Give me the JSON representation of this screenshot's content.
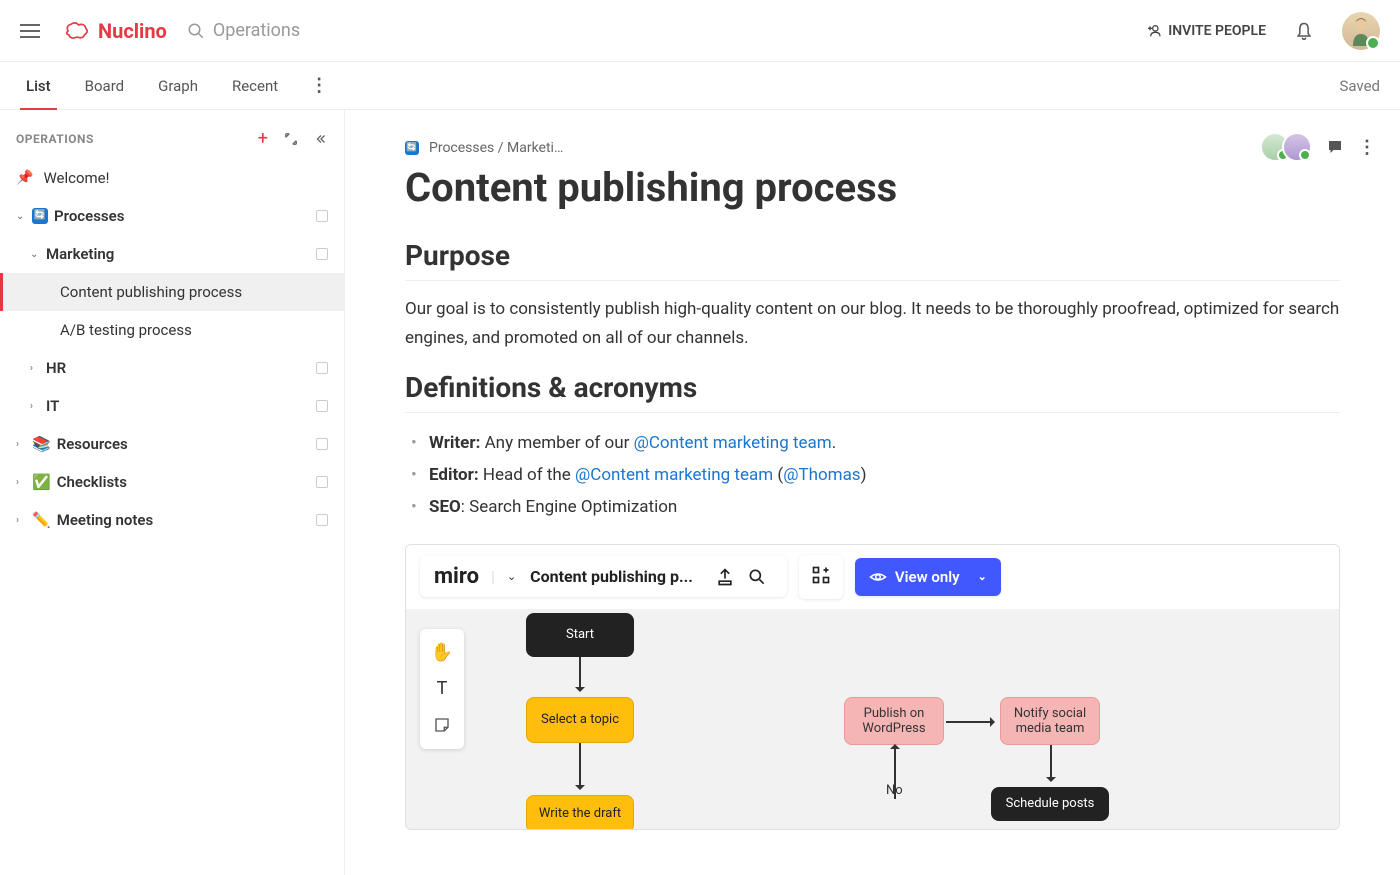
{
  "header": {
    "logo": "Nuclino",
    "search_placeholder": "Operations",
    "invite_label": "INVITE PEOPLE",
    "saved_label": "Saved"
  },
  "tabs": {
    "list": "List",
    "board": "Board",
    "graph": "Graph",
    "recent": "Recent"
  },
  "sidebar": {
    "label": "OPERATIONS",
    "welcome": "Welcome!",
    "processes": "Processes",
    "marketing": "Marketing",
    "content_publishing": "Content publishing process",
    "ab_testing": "A/B testing process",
    "hr": "HR",
    "it": "IT",
    "resources": "Resources",
    "checklists": "Checklists",
    "meeting_notes": "Meeting notes"
  },
  "page": {
    "breadcrumb": "Processes / Marketi…",
    "title": "Content publishing process",
    "purpose_h": "Purpose",
    "purpose_body": "Our goal is to consistently publish high-quality content on our blog. It needs to be thoroughly proofread, optimized for search engines, and promoted on all of our channels.",
    "defs_h": "Definitions & acronyms",
    "writer_label": "Writer:",
    "writer_text": " Any member of our ",
    "mention_team": "@Content marketing team",
    "editor_label": "Editor:",
    "editor_text": " Head of the ",
    "editor_paren_open": " (",
    "mention_thomas": "@Thomas",
    "editor_paren_close": ")",
    "seo_label": "SEO",
    "seo_text": ": Search Engine Optimization"
  },
  "miro": {
    "logo": "miro",
    "title": "Content publishing p...",
    "viewonly": "View only",
    "node_start": "Start",
    "node_topic": "Select a topic",
    "node_draft": "Write the draft",
    "node_wp": "Publish on WordPress",
    "node_notify": "Notify social media team",
    "node_sched": "Schedule posts",
    "node_no": "No"
  }
}
